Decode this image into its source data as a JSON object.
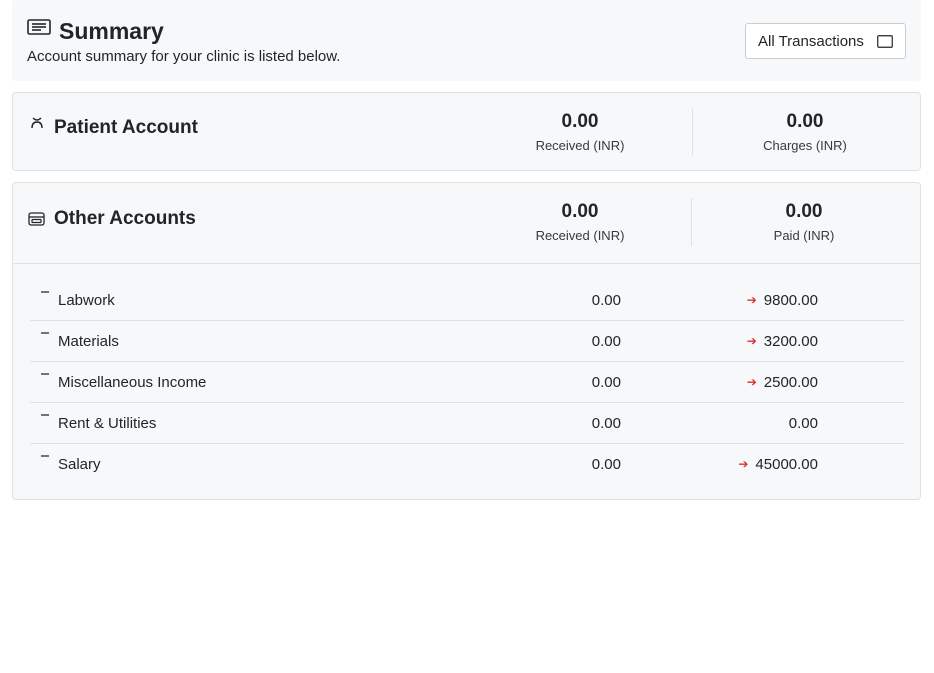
{
  "header": {
    "title": "Summary",
    "subtitle": "Account summary for your clinic is listed below.",
    "filter_button": "All Transactions"
  },
  "patient_account": {
    "title": "Patient Account",
    "received_value": "0.00",
    "received_label": "Received (INR)",
    "charges_value": "0.00",
    "charges_label": "Charges (INR)"
  },
  "other_accounts": {
    "title": "Other Accounts",
    "received_value": "0.00",
    "received_label": "Received (INR)",
    "paid_value": "0.00",
    "paid_label": "Paid (INR)",
    "rows": [
      {
        "name": "Labwork",
        "received": "0.00",
        "paid": "9800.00",
        "paid_arrow": true
      },
      {
        "name": "Materials",
        "received": "0.00",
        "paid": "3200.00",
        "paid_arrow": true
      },
      {
        "name": "Miscellaneous Income",
        "received": "0.00",
        "paid": "2500.00",
        "paid_arrow": true
      },
      {
        "name": "Rent & Utilities",
        "received": "0.00",
        "paid": "0.00",
        "paid_arrow": false
      },
      {
        "name": "Salary",
        "received": "0.00",
        "paid": "45000.00",
        "paid_arrow": true
      }
    ]
  },
  "icons": {
    "summary": "list-icon",
    "filter_button": "window-icon",
    "patient": "person-icon",
    "other": "wallet-icon",
    "row": "dash-icon",
    "paid_arrow": "arrow-right-icon"
  },
  "colors": {
    "panel_bg": "#f7f8fa",
    "border": "#dfe2e5",
    "arrow": "#d92f2f"
  }
}
